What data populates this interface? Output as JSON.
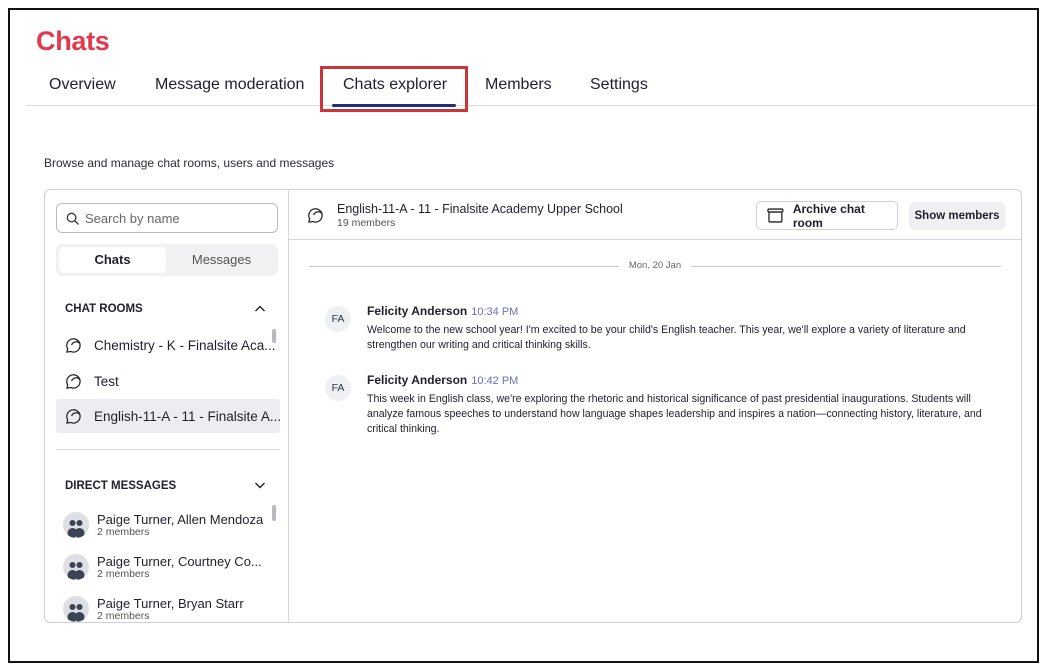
{
  "app": {
    "title": "Chats"
  },
  "tabs": [
    {
      "label": "Overview"
    },
    {
      "label": "Message moderation"
    },
    {
      "label": "Chats explorer"
    },
    {
      "label": "Members"
    },
    {
      "label": "Settings"
    }
  ],
  "subtitle": "Browse and manage chat rooms, users and messages",
  "sidebar": {
    "search_placeholder": "Search by name",
    "segments": {
      "chats": "Chats",
      "messages": "Messages"
    },
    "chat_rooms_heading": "CHAT ROOMS",
    "rooms": [
      {
        "label": "Chemistry - K - Finalsite Aca..."
      },
      {
        "label": "Test"
      },
      {
        "label": "English-11-A - 11 - Finalsite A..."
      }
    ],
    "direct_messages_heading": "DIRECT MESSAGES",
    "dms": [
      {
        "name": "Paige Turner, Allen Mendoza",
        "count": "2 members"
      },
      {
        "name": "Paige Turner, Courtney Co...",
        "count": "2 members"
      },
      {
        "name": "Paige Turner, Bryan Starr",
        "count": "2 members"
      }
    ]
  },
  "room": {
    "name": "English-11-A - 11 - Finalsite Academy Upper School",
    "members": "19 members",
    "archive_label": "Archive chat room",
    "show_members_label": "Show members"
  },
  "conversation": {
    "date": "Mon, 20 Jan",
    "messages": [
      {
        "initials": "FA",
        "author": "Felicity Anderson",
        "time": "10:34 PM",
        "text": "Welcome to the new school year! I'm excited to be your child's English teacher. This year, we'll explore a variety of literature and strengthen our writing and critical thinking skills."
      },
      {
        "initials": "FA",
        "author": "Felicity Anderson",
        "time": "10:42 PM",
        "text": "This week in English class, we're exploring the rhetoric and historical significance of past presidential inaugurations. Students will analyze famous speeches to understand how language shapes leadership and inspires a nation—connecting history, literature, and critical thinking."
      }
    ]
  },
  "colors": {
    "brand": "#e23a4c",
    "tab_underline": "#20307a",
    "highlight": "#c8353a",
    "timestamp": "#6b70b8"
  },
  "icons": {
    "search": "search-icon",
    "room": "chat-bubbles-icon",
    "collapse": "chevron-up-icon",
    "expand": "chevron-down-icon",
    "group_avatar": "group-avatar-icon",
    "archive": "archive-box-icon"
  }
}
